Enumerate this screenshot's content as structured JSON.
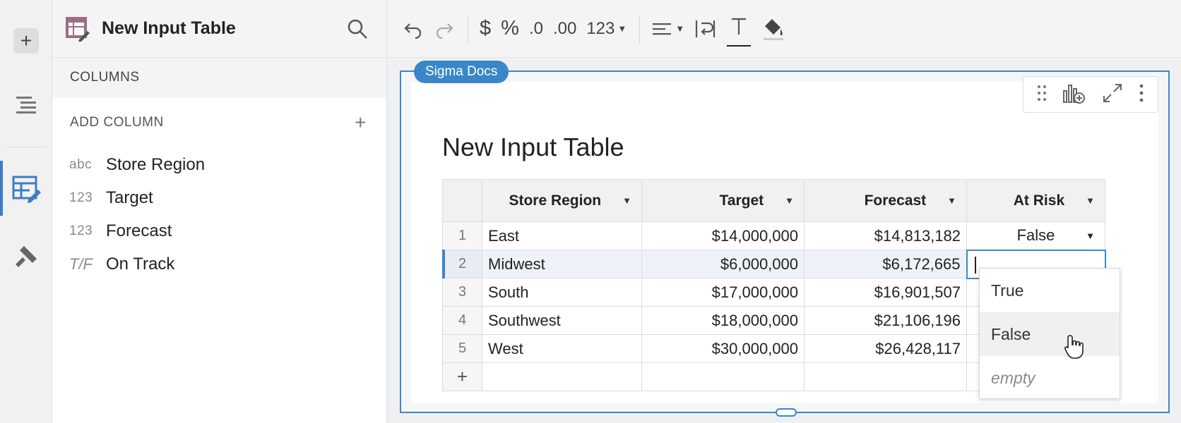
{
  "rail": {
    "icons": [
      "plus-icon",
      "outline-icon",
      "input-table-icon",
      "format-brush-icon"
    ]
  },
  "sidebar": {
    "title": "New Input Table",
    "columns_heading": "COLUMNS",
    "add_column_label": "ADD COLUMN",
    "add_column_plus": "+",
    "columns": [
      {
        "type": "abc",
        "name": "Store Region"
      },
      {
        "type": "123",
        "name": "Target"
      },
      {
        "type": "123",
        "name": "Forecast"
      },
      {
        "type": "T/F",
        "name": "On Track"
      }
    ]
  },
  "toolbar": {
    "currency": "$",
    "percent": "%",
    "decrease_decimals": ".0",
    "increase_decimals": ".00",
    "number_format": "123"
  },
  "element": {
    "source_tag": "Sigma Docs",
    "title": "New Input Table",
    "table": {
      "headers": [
        "Store Region",
        "Target",
        "Forecast",
        "At Risk"
      ],
      "rows": [
        {
          "num": "1",
          "region": "East",
          "target": "$14,000,000",
          "forecast": "$14,813,182",
          "at_risk": "False"
        },
        {
          "num": "2",
          "region": "Midwest",
          "target": "$6,000,000",
          "forecast": "$6,172,665",
          "at_risk": ""
        },
        {
          "num": "3",
          "region": "South",
          "target": "$17,000,000",
          "forecast": "$16,901,507",
          "at_risk": ""
        },
        {
          "num": "4",
          "region": "Southwest",
          "target": "$18,000,000",
          "forecast": "$21,106,196",
          "at_risk": ""
        },
        {
          "num": "5",
          "region": "West",
          "target": "$30,000,000",
          "forecast": "$26,428,117",
          "at_risk": ""
        }
      ],
      "add_row": "+"
    },
    "dropdown_options": [
      "True",
      "False",
      "empty"
    ]
  },
  "colors": {
    "accent": "#3f86c7",
    "rail_bg": "#f1f1f2"
  }
}
